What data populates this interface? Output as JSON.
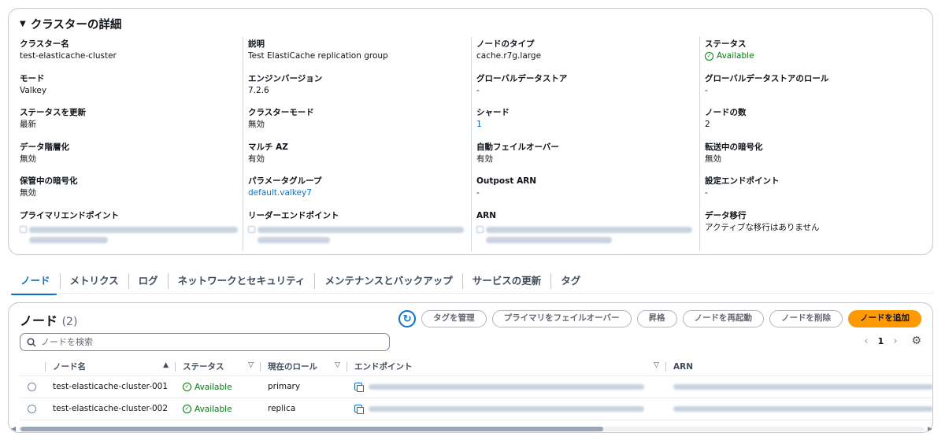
{
  "details": {
    "title": "クラスターの詳細",
    "columns": [
      [
        {
          "label": "クラスター名",
          "value": "test-elasticache-cluster"
        },
        {
          "label": "モード",
          "value": "Valkey"
        },
        {
          "label": "ステータスを更新",
          "value": "最新"
        },
        {
          "label": "データ階層化",
          "value": "無効"
        },
        {
          "label": "保管中の暗号化",
          "value": "無効"
        },
        {
          "label": "プライマリエンドポイント",
          "value": ""
        }
      ],
      [
        {
          "label": "説明",
          "value": "Test ElastiCache replication group"
        },
        {
          "label": "エンジンバージョン",
          "value": "7.2.6"
        },
        {
          "label": "クラスターモード",
          "value": "無効"
        },
        {
          "label": "マルチ AZ",
          "value": "有効"
        },
        {
          "label": "パラメータグループ",
          "value": "default.valkey7"
        },
        {
          "label": "リーダーエンドポイント",
          "value": ""
        }
      ],
      [
        {
          "label": "ノードのタイプ",
          "value": "cache.r7g.large"
        },
        {
          "label": "グローバルデータストア",
          "value": "-"
        },
        {
          "label": "シャード",
          "value": "1"
        },
        {
          "label": "自動フェイルオーバー",
          "value": "有効"
        },
        {
          "label": "Outpost ARN",
          "value": "-"
        },
        {
          "label": "ARN",
          "value": ""
        }
      ],
      [
        {
          "label": "ステータス",
          "value": "Available"
        },
        {
          "label": "グローバルデータストアのロール",
          "value": "-"
        },
        {
          "label": "ノードの数",
          "value": "2"
        },
        {
          "label": "転送中の暗号化",
          "value": "無効"
        },
        {
          "label": "設定エンドポイント",
          "value": "-"
        },
        {
          "label": "データ移行",
          "value": "アクティブな移行はありません"
        }
      ]
    ]
  },
  "tabs": [
    "ノード",
    "メトリクス",
    "ログ",
    "ネットワークとセキュリティ",
    "メンテナンスとバックアップ",
    "サービスの更新",
    "タグ"
  ],
  "nodes": {
    "title": "ノード",
    "count": "(2)",
    "buttons": {
      "manage_tags": "タグを管理",
      "failover": "プライマリをフェイルオーバー",
      "promote": "昇格",
      "reboot": "ノードを再起動",
      "delete": "ノードを削除",
      "add": "ノードを追加"
    },
    "search_placeholder": "ノードを検索",
    "page": "1",
    "columns": [
      "ノード名",
      "ステータス",
      "現在のロール",
      "エンドポイント",
      "ARN"
    ],
    "rows": [
      {
        "name": "test-elasticache-cluster-001",
        "status": "Available",
        "role": "primary"
      },
      {
        "name": "test-elasticache-cluster-002",
        "status": "Available",
        "role": "replica"
      }
    ]
  },
  "colors": {
    "accent": "#0972d3",
    "success": "#037f0c",
    "primary_button": "#ff9900"
  },
  "icons": [
    "caret-down-icon",
    "check-circle-icon",
    "refresh-icon",
    "search-icon",
    "chevron-left-icon",
    "chevron-right-icon",
    "gear-icon",
    "copy-icon",
    "sort-asc-icon",
    "sort-desc-icon"
  ]
}
